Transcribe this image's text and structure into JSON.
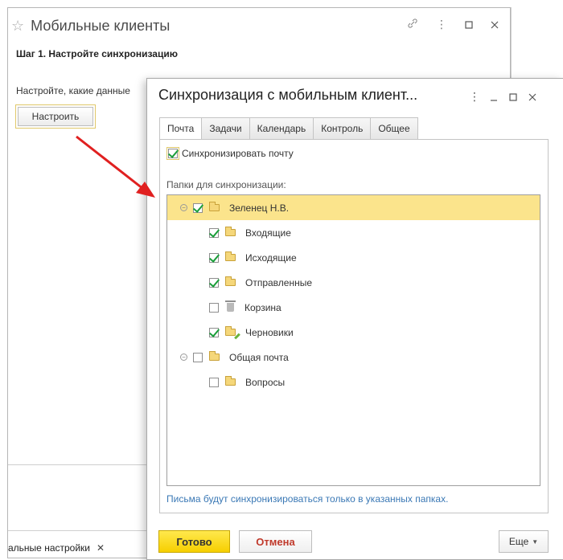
{
  "background_window": {
    "title": "Мобильные клиенты",
    "step_title": "Шаг 1. Настройте синхронизацию",
    "setup_text": "Настройте, какие данные",
    "setup_button": "Настроить",
    "bottom_tab": "альные настройки",
    "icons": [
      "star-icon",
      "link-icon",
      "more-icon",
      "maximize-icon",
      "close-icon"
    ]
  },
  "dialog": {
    "title": "Синхронизация с мобильным клиент...",
    "tabs": [
      {
        "label": "Почта",
        "active": true
      },
      {
        "label": "Задачи",
        "active": false
      },
      {
        "label": "Календарь",
        "active": false
      },
      {
        "label": "Контроль",
        "active": false
      },
      {
        "label": "Общее",
        "active": false
      }
    ],
    "sync_mail": {
      "label": "Синхронизировать почту",
      "checked": true
    },
    "folders_label": "Папки для синхронизации:",
    "tree": [
      {
        "label": "Зеленец Н.В.",
        "level": 0,
        "checked": true,
        "icon": "folder-icon",
        "collapsible": true,
        "selected": true
      },
      {
        "label": "Входящие",
        "level": 1,
        "checked": true,
        "icon": "folder-icon"
      },
      {
        "label": "Исходящие",
        "level": 1,
        "checked": true,
        "icon": "folder-icon"
      },
      {
        "label": "Отправленные",
        "level": 1,
        "checked": true,
        "icon": "folder-icon"
      },
      {
        "label": "Корзина",
        "level": 1,
        "checked": false,
        "icon": "trash-icon"
      },
      {
        "label": "Черновики",
        "level": 1,
        "checked": true,
        "icon": "draft-folder-icon"
      },
      {
        "label": "Общая почта",
        "level": 0,
        "checked": false,
        "icon": "folder-icon",
        "collapsible": true
      },
      {
        "label": "Вопросы",
        "level": 1,
        "checked": false,
        "icon": "folder-icon"
      }
    ],
    "hint": "Письма будут синхронизироваться только в указанных папках.",
    "ready_button": "Готово",
    "cancel_button": "Отмена",
    "more_button": "Еще"
  },
  "colors": {
    "accent_yellow": "#f6cf00",
    "selection": "#fbe48c",
    "check_green": "#1a9e3a",
    "cancel_red": "#c0392b",
    "hint_blue": "#3a78b5",
    "arrow_red": "#e02020"
  }
}
